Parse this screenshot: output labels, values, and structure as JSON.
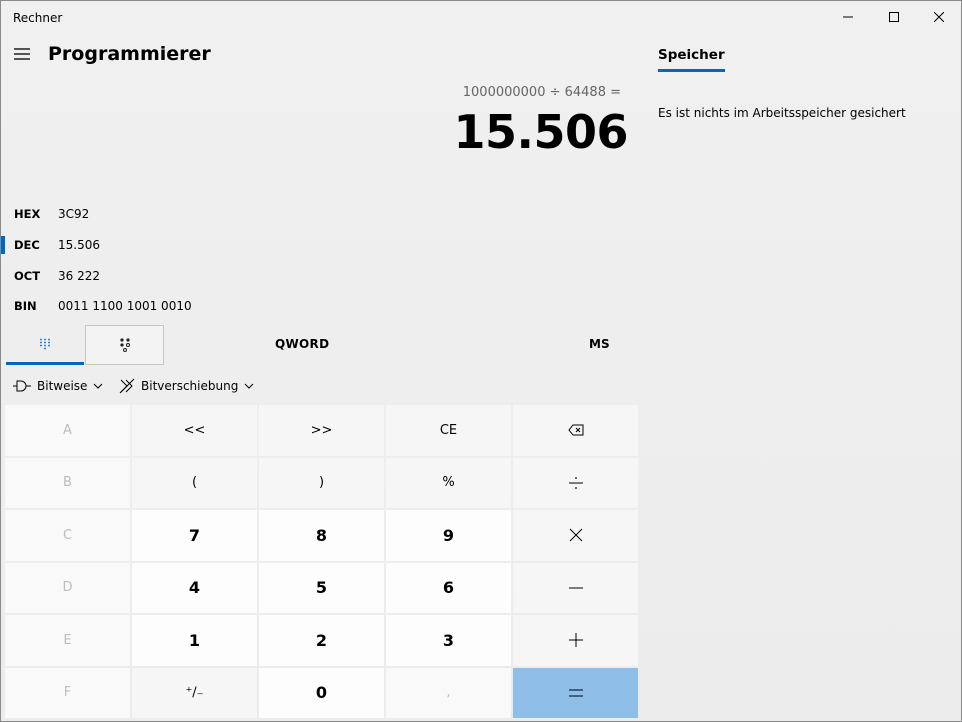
{
  "window": {
    "title": "Rechner"
  },
  "header": {
    "mode_title": "Programmierer"
  },
  "display": {
    "expression": "1000000000 ÷ 64488 =",
    "result": "15.506"
  },
  "radix": [
    {
      "label": "HEX",
      "value": "3C92",
      "active": false
    },
    {
      "label": "DEC",
      "value": "15.506",
      "active": true
    },
    {
      "label": "OCT",
      "value": "36 222",
      "active": false
    },
    {
      "label": "BIN",
      "value": "0011 1100 1001 0010",
      "active": false
    }
  ],
  "tabs": {
    "word_size": "QWORD",
    "memory_store": "MS"
  },
  "operations": {
    "bitwise": "Bitweise",
    "bitshift": "Bitverschiebung"
  },
  "keys": {
    "a": "A",
    "lshift": "<<",
    "rshift": ">>",
    "ce": "CE",
    "b": "B",
    "lparen": "(",
    "rparen": ")",
    "percent": "%",
    "c": "C",
    "seven": "7",
    "eight": "8",
    "nine": "9",
    "d": "D",
    "four": "4",
    "five": "5",
    "six": "6",
    "e": "E",
    "one": "1",
    "two": "2",
    "three": "3",
    "f": "F",
    "plusminus": "⁺∕₋",
    "zero": "0",
    "decimal": ","
  },
  "memory": {
    "tab_label": "Speicher",
    "empty_message": "Es ist nichts im Arbeitsspeicher gesichert"
  },
  "colors": {
    "accent": "#0067c0",
    "equals_bg": "#8fbfe8"
  },
  "icons": {
    "menu": "hamburger-icon",
    "backspace": "backspace-icon",
    "divide": "divide-icon",
    "multiply": "multiply-icon",
    "subtract": "minus-icon",
    "add": "plus-icon",
    "equals": "equals-icon"
  }
}
